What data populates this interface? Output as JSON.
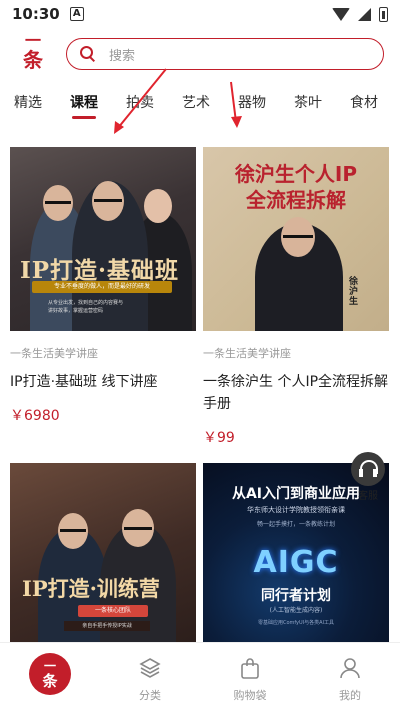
{
  "status_bar": {
    "time": "10:30",
    "notification_icon": "A"
  },
  "header": {
    "logo_line1": "一",
    "logo_line2": "条",
    "search_placeholder": "搜索"
  },
  "tabs": [
    {
      "label": "精选"
    },
    {
      "label": "课程"
    },
    {
      "label": "拍卖"
    },
    {
      "label": "艺术"
    },
    {
      "label": "器物"
    },
    {
      "label": "茶叶"
    },
    {
      "label": "食材"
    }
  ],
  "active_tab": "课程",
  "products": [
    {
      "category": "一条生活美学讲座",
      "title": "IP打造·基础班 线下讲座",
      "price": "￥6980",
      "thumb": {
        "headline": "IP打造·基础班",
        "banner": "专业不垂度的做人，而是最好的研发",
        "line1": "从专业出发，找到自己的内容赛与",
        "line2": "讲好故事，掌握运营密码"
      }
    },
    {
      "category": "一条生活美学讲座",
      "title": "一条徐沪生 个人IP全流程拆解手册",
      "price": "￥99",
      "thumb": {
        "headline1": "徐沪生个人IP",
        "headline2": "全流程拆解",
        "side_label": "徐沪生"
      }
    },
    {
      "category": "",
      "title": "",
      "price": "",
      "thumb": {
        "headline": "IP打造·训练营",
        "tag": "一条核心团队",
        "line": "亲自手把手传授IP实战"
      }
    },
    {
      "category": "",
      "title": "",
      "price": "",
      "thumb": {
        "headline": "从AI入门到商业应用",
        "sub1": "华东师大设计学院教授领衔亲课",
        "sub2": "畅一起手摸打，一条教练计划",
        "big": "AIGC",
        "plan": "同行者计划",
        "plan_sub": "(人工智能生成内容)",
        "foot": "零基础应用ComfyUI与各类AI工具"
      }
    }
  ],
  "service": {
    "label": "客服"
  },
  "bottom_nav": [
    {
      "label": "",
      "home_line1": "一",
      "home_line2": "条"
    },
    {
      "label": "分类"
    },
    {
      "label": "购物袋"
    },
    {
      "label": "我的"
    }
  ],
  "colors": {
    "accent": "#c21e2a",
    "muted": "#999999"
  },
  "icons": [
    "search-icon",
    "wifi-icon",
    "signal-icon",
    "battery-icon",
    "headset-icon",
    "layers-icon",
    "shopping-bag-icon",
    "user-icon"
  ]
}
